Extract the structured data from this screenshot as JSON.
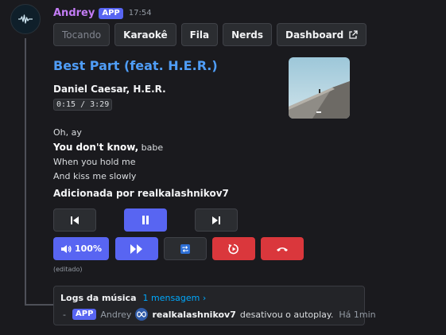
{
  "message": {
    "author": "Andrey",
    "badge": "APP",
    "timestamp": "17:54"
  },
  "tabs": [
    {
      "label": "Tocando"
    },
    {
      "label": "Karaokê"
    },
    {
      "label": "Fila"
    },
    {
      "label": "Nerds"
    },
    {
      "label": "Dashboard"
    }
  ],
  "player": {
    "title": "Best Part (feat. H.E.R.)",
    "artist": "Daniel Caesar, H.E.R.",
    "progress": "0:15 / 3:29",
    "lyrics": {
      "line1": "Oh, ay",
      "line2_bold": "You don't know,",
      "line2_rest": " babe",
      "line3": "When you hold me",
      "line4": "And kiss me slowly"
    },
    "added_by": "Adicionada por realkalashnikov7",
    "volume_label": "100%",
    "edited": "(editado)"
  },
  "logs": {
    "title": "Logs da música",
    "link": "1 mensagem ›",
    "entry": {
      "bullet": "-",
      "badge": "APP",
      "author": "Andrey",
      "user": "realkalashnikov7",
      "action": " desativou o autoplay.",
      "time": "Há 1min"
    }
  },
  "colors": {
    "accent": "#5865f2",
    "danger": "#da373c",
    "title": "#4f9df7",
    "author": "#c27cf4"
  }
}
